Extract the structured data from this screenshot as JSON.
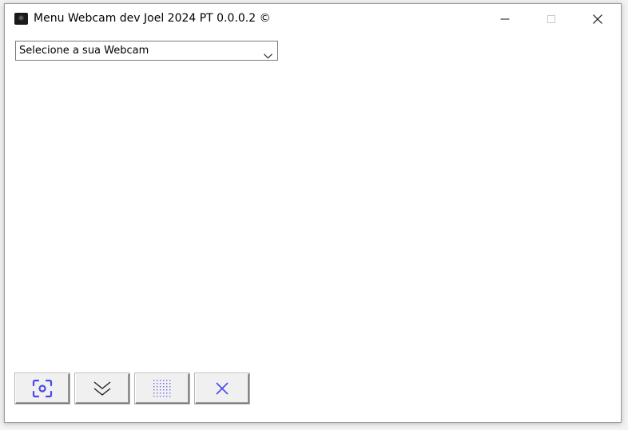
{
  "window": {
    "title": "Menu Webcam dev Joel 2024 PT 0.0.0.2 ©",
    "icon": "webcam-icon",
    "caption_buttons": [
      "minimize-icon",
      "maximize-icon",
      "close-icon"
    ]
  },
  "webcam_select": {
    "selected": "Selecione a sua Webcam",
    "icon": "chevron-down-icon"
  },
  "toolbar": {
    "buttons": [
      {
        "name": "capture-button",
        "icon": "camera-capture-icon"
      },
      {
        "name": "expand-down-button",
        "icon": "double-chevron-down-icon"
      },
      {
        "name": "grid-button",
        "icon": "dotted-grid-icon"
      },
      {
        "name": "close-button",
        "icon": "close-icon"
      }
    ]
  },
  "colors": {
    "icon_accent": "#4a4ae8",
    "window_bg": "#ffffff",
    "button_bg": "#f0f0f0"
  }
}
